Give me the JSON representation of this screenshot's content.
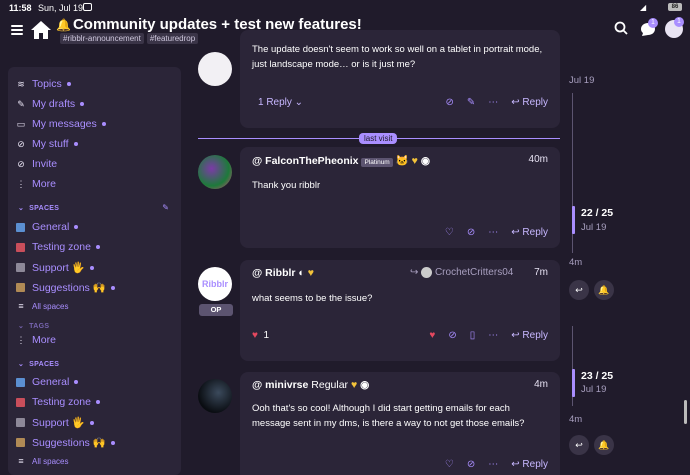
{
  "status_bar": {
    "time": "11:58",
    "date": "Sun, Jul 19",
    "signal": "5G",
    "battery": "86"
  },
  "header": {
    "title": "Community updates + test new features!",
    "tags": [
      "#ribblr-announcement",
      "#featuredrop"
    ],
    "chat_badge": "1",
    "avatar_badge": "1"
  },
  "sidebar": {
    "items": [
      {
        "label": "Topics",
        "icon": "layers-icon"
      },
      {
        "label": "My drafts",
        "icon": "pencil-icon"
      },
      {
        "label": "My messages",
        "icon": "inbox-icon"
      },
      {
        "label": "My stuff",
        "icon": "link-icon"
      },
      {
        "label": "Invite",
        "icon": "link-icon"
      },
      {
        "label": "More",
        "icon": "dots-icon"
      }
    ],
    "spaces_header": "SPACES",
    "spaces": [
      {
        "label": "General",
        "color": "#5b8fd1"
      },
      {
        "label": "Testing zone",
        "color": "#c94e5b"
      },
      {
        "label": "Support 🖐",
        "color": "#8d8898"
      },
      {
        "label": "Suggestions 🙌",
        "color": "#b08a55"
      }
    ],
    "all_spaces": "All spaces",
    "tags_header": "TAGS",
    "more_label": "More",
    "spaces_header_2": "SPACES",
    "spaces_2": [
      {
        "label": "General",
        "color": "#5b8fd1"
      },
      {
        "label": "Testing zone",
        "color": "#c94e5b"
      },
      {
        "label": "Support 🖐",
        "color": "#8d8898"
      },
      {
        "label": "Suggestions 🙌",
        "color": "#b08a55"
      }
    ],
    "all_spaces_2": "All spaces"
  },
  "posts": [
    {
      "body": "The update doesn't seem to work so well on a tablet in portrait mode, just landscape mode… or is it just me?",
      "replies": "1 Reply",
      "reply_label": "Reply"
    },
    {
      "username": "@ FalconThePheonix",
      "badge": "Platinum",
      "time": "40m",
      "body": "Thank you ribblr",
      "reply_label": "Reply"
    },
    {
      "username": "@ Ribblr",
      "reply_to": "CrochetCritters04",
      "time": "7m",
      "body": "what seems to be the issue?",
      "likes": "1",
      "op_label": "OP",
      "reply_label": "Reply"
    },
    {
      "username": "@ minivrse",
      "title": "Regular",
      "time": "4m",
      "body": "Ooh that's so cool! Although I did start getting emails for each message sent in my dms, is there a way to not get those emails?",
      "reply_label": "Reply"
    }
  ],
  "last_visit": "last visit",
  "timeline": {
    "top_date": "Jul 19",
    "pos1": "22 / 25",
    "pos1_date": "Jul 19",
    "ago1": "4m",
    "pos2": "23 / 25",
    "pos2_date": "Jul 19",
    "ago2": "4m"
  },
  "colors": {
    "accent": "#a98eff",
    "background": "#201b2b",
    "card": "#2b2538"
  }
}
